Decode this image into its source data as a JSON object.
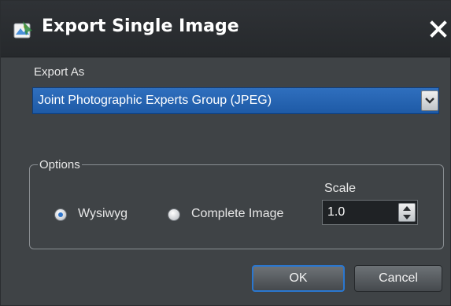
{
  "window": {
    "title": "Export Single Image",
    "icon": "export-image-icon",
    "close_icon": "close-icon"
  },
  "export_as": {
    "label": "Export As",
    "selected_format": "Joint Photographic Experts Group (JPEG)"
  },
  "options": {
    "legend": "Options",
    "radios": [
      {
        "label": "Wysiwyg",
        "selected": true
      },
      {
        "label": "Complete Image",
        "selected": false
      }
    ],
    "scale": {
      "label": "Scale",
      "value": "1.0"
    }
  },
  "buttons": {
    "ok": "OK",
    "cancel": "Cancel"
  },
  "colors": {
    "dialog_bg": "#3f4346",
    "titlebar_bg": "#2b2e31",
    "selection_blue": "#2466b4",
    "focus_border": "#2a77d0"
  }
}
